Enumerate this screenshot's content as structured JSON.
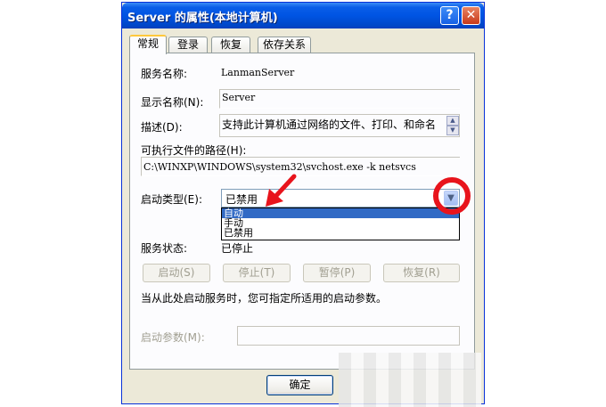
{
  "window": {
    "title": "Server 的属性(本地计算机)",
    "help_glyph": "?",
    "close_glyph": "✕"
  },
  "tabs": [
    {
      "label": "常规",
      "active": true
    },
    {
      "label": "登录",
      "active": false
    },
    {
      "label": "恢复",
      "active": false
    },
    {
      "label": "依存关系",
      "active": false
    }
  ],
  "general": {
    "service_name_label": "服务名称:",
    "service_name_value": "LanmanServer",
    "display_name_label": "显示名称(N):",
    "display_name_value": "Server",
    "description_label": "描述(D):",
    "description_value": "支持此计算机通过网络的文件、打印、和命名",
    "exe_path_label": "可执行文件的路径(H):",
    "exe_path_value": "C:\\WINXP\\WINDOWS\\system32\\svchost.exe -k netsvcs",
    "startup_type_label": "启动类型(E):",
    "startup_type_value": "已禁用",
    "startup_options": [
      "自动",
      "手动",
      "已禁用"
    ],
    "startup_selected_index": 0,
    "service_status_label": "服务状态:",
    "service_status_value": "已停止",
    "buttons": {
      "start": "启动(S)",
      "stop": "停止(T)",
      "pause": "暂停(P)",
      "resume": "恢复(R)"
    },
    "hint": "当从此处启动服务时，您可指定所适用的启动参数。",
    "start_params_label": "启动参数(M):",
    "start_params_value": ""
  },
  "footer": {
    "ok_label": "确定"
  },
  "colors": {
    "titlebar": "#0054e3",
    "selection": "#316ac5",
    "annotation": "#e8141c"
  }
}
